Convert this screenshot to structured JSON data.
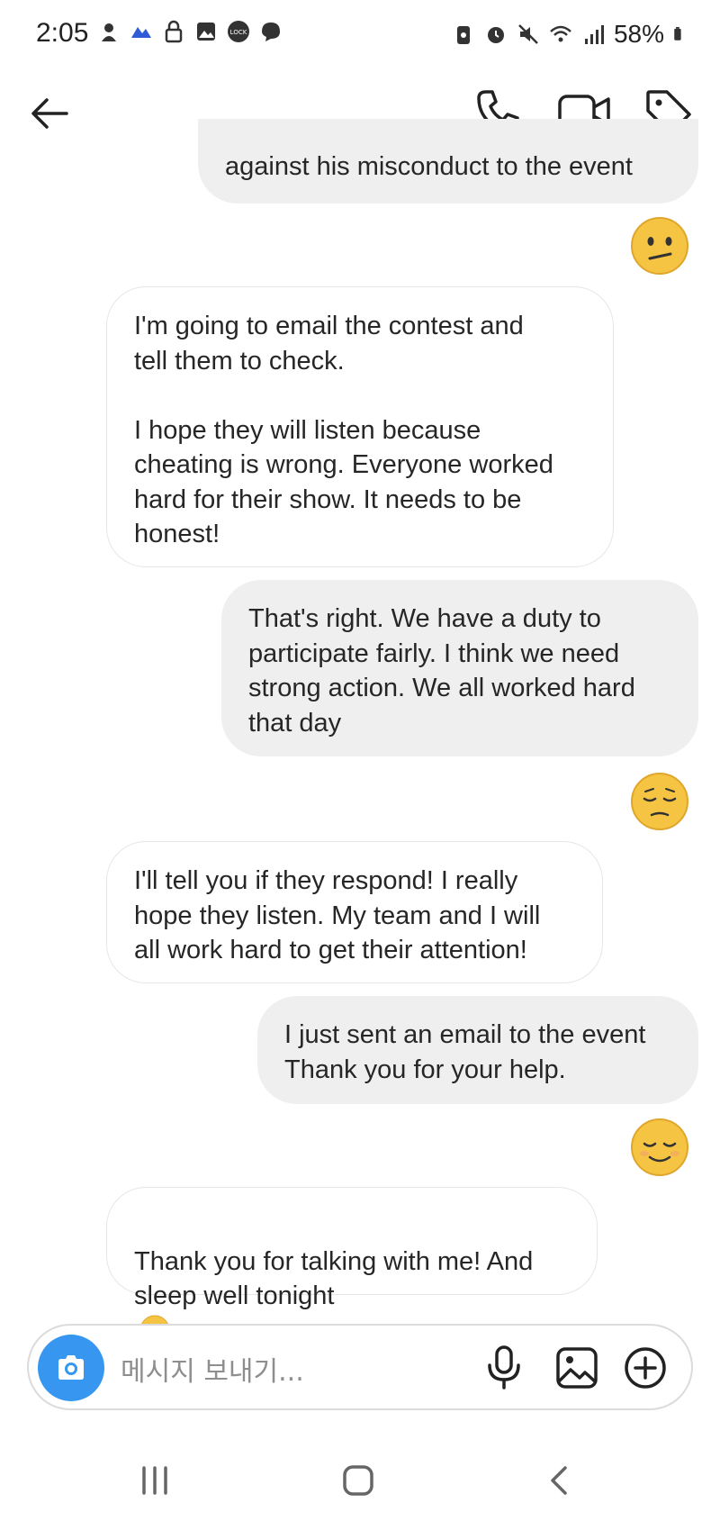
{
  "status_bar": {
    "time": "2:05",
    "battery_percent": "58%"
  },
  "header": {
    "contact_name": ""
  },
  "messages": [
    {
      "side": "out",
      "text": "against his misconduct to the event"
    },
    {
      "side": "out-emoji",
      "emoji": "confused-face-emoji"
    },
    {
      "side": "in",
      "text": "I'm going to email the contest and\ntell them to check.\n\nI hope they will listen because\ncheating is wrong. Everyone worked\nhard for their show. It needs to be\nhonest!"
    },
    {
      "side": "out",
      "text": "That's right. We have a duty to\nparticipate fairly. I think we need\nstrong action. We all worked hard\nthat day"
    },
    {
      "side": "out-emoji",
      "emoji": "pensive-face-emoji"
    },
    {
      "side": "in",
      "text": "I'll tell you if they respond! I really\nhope they listen. My team and I will\nall work hard to get their attention!"
    },
    {
      "side": "out",
      "text": "I just sent an email to the event\nThank you for your help."
    },
    {
      "side": "out-emoji",
      "emoji": "relieved-face-emoji"
    },
    {
      "side": "in",
      "text": "Thank you for talking with me! And\nsleep well tonight"
    }
  ],
  "composer": {
    "placeholder": "메시지 보내기..."
  },
  "colors": {
    "accent": "#3797f0",
    "incoming_bubble": "#ffffff",
    "outgoing_bubble": "#efefef",
    "text": "#262626",
    "placeholder": "#8e8e8e"
  }
}
